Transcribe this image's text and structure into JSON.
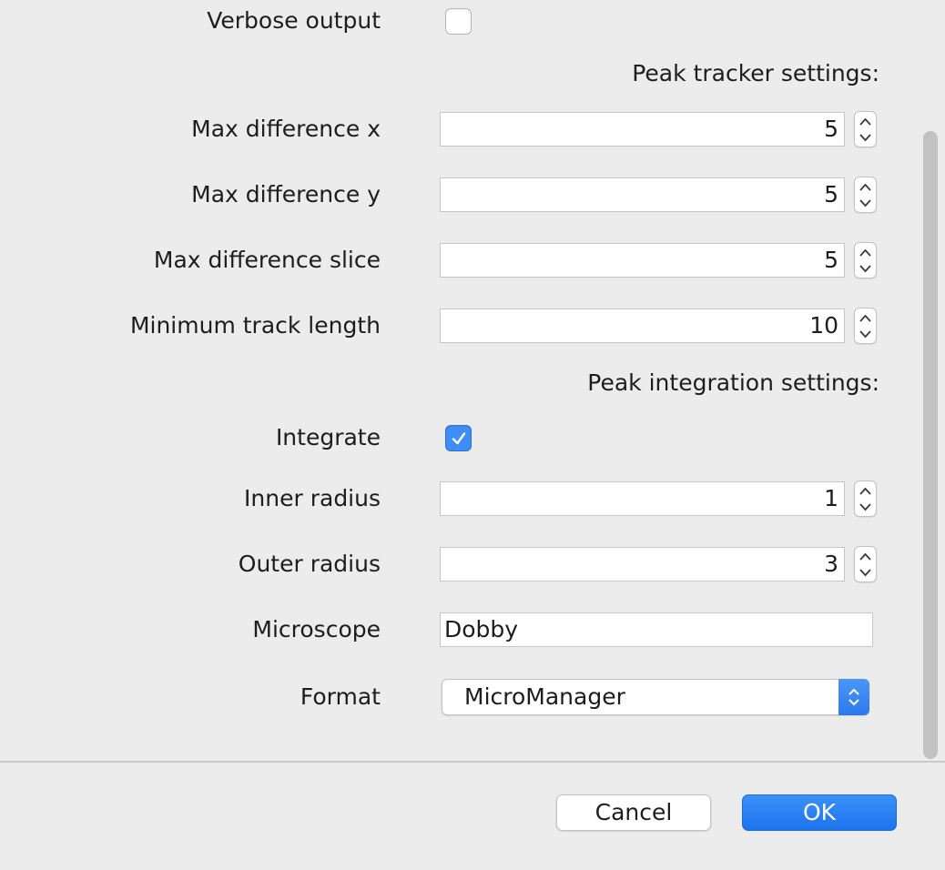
{
  "form": {
    "verbose": {
      "label": "Verbose output",
      "checked": false
    },
    "tracker_title": "Peak tracker settings:",
    "max_diff_x": {
      "label": "Max difference x",
      "value": "5"
    },
    "max_diff_y": {
      "label": "Max difference y",
      "value": "5"
    },
    "max_diff_slice": {
      "label": "Max difference slice",
      "value": "5"
    },
    "min_track_length": {
      "label": "Minimum track length",
      "value": "10"
    },
    "integration_title": "Peak integration settings:",
    "integrate": {
      "label": "Integrate",
      "checked": true
    },
    "inner_radius": {
      "label": "Inner radius",
      "value": "1"
    },
    "outer_radius": {
      "label": "Outer radius",
      "value": "3"
    },
    "microscope": {
      "label": "Microscope",
      "value": "Dobby"
    },
    "format": {
      "label": "Format",
      "selected": "MicroManager"
    }
  },
  "buttons": {
    "cancel": "Cancel",
    "ok": "OK"
  },
  "colors": {
    "accent": "#3f8ef5",
    "background": "#ececec"
  },
  "icons": {
    "check": "checkmark-icon",
    "stepper_up": "chevron-up-icon",
    "stepper_down": "chevron-down-icon",
    "select": "up-down-arrows-icon"
  }
}
